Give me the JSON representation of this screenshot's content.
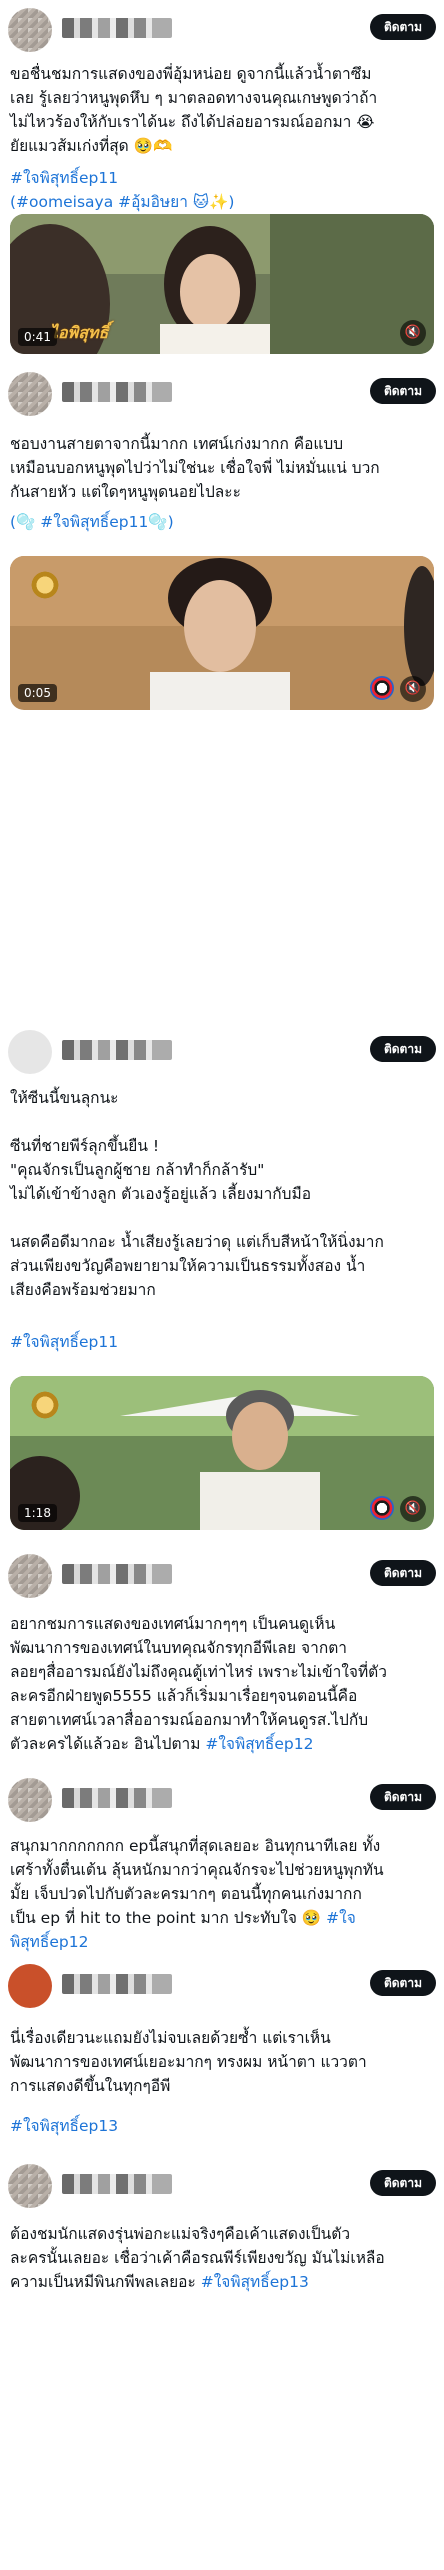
{
  "follow_label": "ติดตาม",
  "posts": [
    {
      "text_main": "ขอชื่นชมการแสดงของพี่อุ้มหน่อย ดูจากนี้แล้วน้ำตาซึม\nเลย รู้เลยว่าหนูพุดหึบ ๆ มาตลอดทางจนคุณเกษพูดว่าถ้า\nไม่ไหวร้องให้กับเราได้นะ ถึงได้ปล่อยอารมณ์ออกมา 😭\nยัยแมวส้มเก่งที่สุด 🥹🫶",
      "tags": "#ใจพิสุทธิ์ep11\n(#oomeisaya #อุ้มอิษยา 🐱✨)",
      "video": {
        "duration": "0:41",
        "watermark": "ไอพิสุทธิ์",
        "muted_icon": "speaker-muted-icon"
      }
    },
    {
      "text_main": "ชอบงานสายตาจากนี้มากก เทศน์เก่งมากก คือแบบ\nเหมือนบอกหนูพุดไปว่าไม่ใช่นะ เชื่อใจพี่ ไม่หมั่นแน่ บวก\nกันสายหัว แต่ใดๆหนูพุดนอยไปละะ",
      "tags_line": "(🫧 #ใจพิสุทธิ์ep11🫧)",
      "video": {
        "duration": "0:05",
        "muted_icon": "speaker-muted-icon"
      }
    },
    {
      "text_main": "ให้ซีนนี้ขนลุกนะ\n\nซีนที่ชายพีร์ลุกขึ้นยืน !\n\"คุณจักรเป็นลูกผู้ชาย กล้าทำก็กล้ารับ\"\nไม่ได้เข้าข้างลูก ตัวเองรู้อยู่แล้ว เลี้ยงมากับมือ\n\nนสดคือดีมากอะ น้ำเสียงรู้เลยว่าดุ แต่เก็บสีหน้าให้นิ่งมาก\nส่วนเพียงขวัญคือพยายามให้ความเป็นธรรมทั้งสอง น้ำ\nเสียงคือพร้อมช่วยมาก",
      "tags": "#ใจพิสุทธิ์ep11",
      "video": {
        "duration": "1:18",
        "muted_icon": "speaker-muted-icon"
      }
    },
    {
      "text_main": "อยากชมการแสดงของเทศน์มากๆๆๆ เป็นคนดูเห็น\nพัฒนาการของเทศน์ในบทคุณจักรทุกอีพีเลย จากตา\nลอยๆสื่ออารมณ์ยังไม่ถึงคุณตู้เท่าไหร่ เพราะไม่เข้าใจที่ตัว\nละครอีกฝ่ายพูด5555 แล้วก็เริ่มมาเรื่อยๆจนตอนนี้คือ\nสายตาเทศน์เวลาสื่ออารมณ์ออกมาทำให้คนดูรส.ไปกับ\nตัวละครได้แล้วอะ อินไปตาม ",
      "tags": "#ใจพิสุทธิ์ep12"
    },
    {
      "text_main": "สนุกมากกกกกกก epนี้สนุกที่สุดเลยอะ อินทุกนาทีเลย ทั้ง\nเศร้าทั้งตื่นเต้น ลุ้นหนักมากว่าคุณจักรจะไปช่วยหนูพุกทัน\nมั้ย เจ็บปวดไปกับตัวละครมากๆ ตอนนี้ทุกคนเก่งมากก\nเป็น ep ที่ hit to the point มาก ประทับใจ 🥹 ",
      "tags_a": "#ใจ",
      "tags_b": "พิสุทธิ์ep12"
    },
    {
      "text_main": "นี่เรื่องเดียวนะแถมยังไม่จบเลยด้วยซ้ำ แต่เราเห็น\nพัฒนาการของเทศน์เยอะมากๆ ทรงผม หน้าตา แววตา\nการแสดงดีขึ้นในทุกๆอีพี",
      "tags": "#ใจพิสุทธิ์ep13"
    },
    {
      "text_main": "ต้องชมนักแสดงรุ่นพ่อกะแม่จริงๆคือเค้าแสดงเป็นตัว\nละครนั้นเลยอะ เชื่อว่าเค้าคือรณพีร์เพียงขวัญ มันไม่เหลือ\nความเป็นหมีพินกพีพลเลยอะ ",
      "tags": "#ใจพิสุทธิ์ep13"
    }
  ],
  "colors": {
    "link": "#1d74d7",
    "follow_bg": "#0f1419",
    "text": "#0f1419"
  }
}
